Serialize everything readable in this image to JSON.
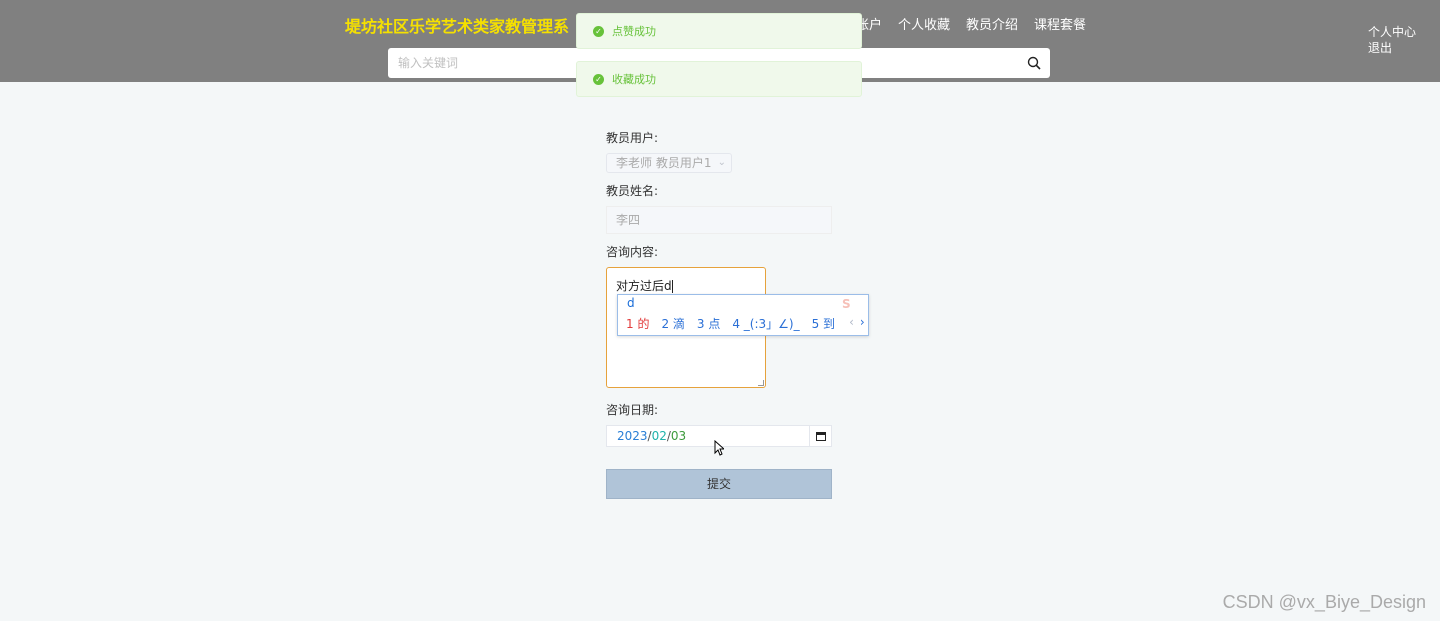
{
  "header": {
    "title": "堤坊社区乐学艺术类家教管理系",
    "nav": [
      "账户",
      "个人收藏",
      "教员介绍",
      "课程套餐"
    ],
    "user_menu": {
      "center": "个人中心",
      "logout": "退出"
    },
    "search": {
      "placeholder": "输入关键词"
    }
  },
  "toasts": [
    "点赞成功",
    "收藏成功"
  ],
  "form": {
    "teacher_user_label": "教员用户:",
    "teacher_user_value": "李老师 教员用户1",
    "teacher_name_label": "教员姓名:",
    "teacher_name_value": "李四",
    "content_label": "咨询内容:",
    "content_value": "对方过后d",
    "date_label": "咨询日期:",
    "date": {
      "year": "2023",
      "month": "02",
      "day": "03"
    },
    "submit_label": "提交"
  },
  "ime": {
    "composition": "d",
    "candidates": [
      "1 的",
      "2 滴",
      "3 点",
      "4 _(:3」∠)_",
      "5 到"
    ],
    "pager_prev": "‹",
    "pager_next": "›"
  },
  "watermark": "CSDN @vx_Biye_Design",
  "colors": {
    "topbar": "#808080",
    "title": "#f5e000",
    "toast_bg": "#f0f9eb",
    "toast_text": "#67c23a",
    "textarea_focus": "#e6a23c",
    "submit_bg": "#b0c4d8"
  },
  "icons": [
    "search-icon",
    "success-icon",
    "chevron-down-icon",
    "calendar-icon",
    "mouse-pointer-icon"
  ]
}
